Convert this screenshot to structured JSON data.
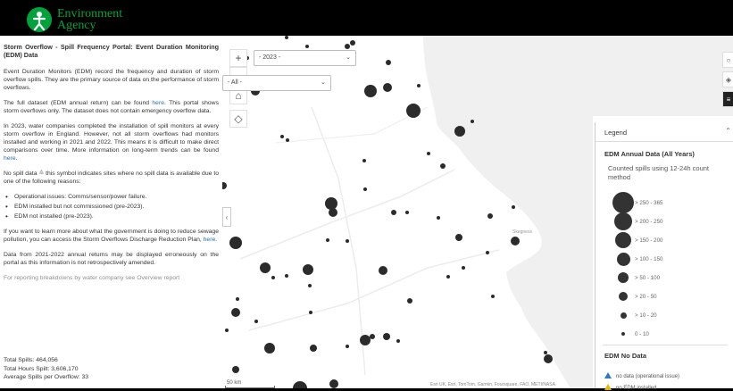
{
  "brand": {
    "name_line1": "Environment",
    "name_line2": "Agency",
    "color": "#00a33b"
  },
  "panel": {
    "title": "Storm Overflow - Spill Frequency Portal: Event Duration Monitoring (EDM) Data",
    "p1": "Event Duration Monitors (EDM) record the frequency and duration of storm overflow spills. They are the primary source of data on the performance of storm overflows.",
    "p2a": "The full dataset (EDM annual return) can be found ",
    "p2link": "here",
    "p2b": ". This portal shows storm overflows only. The dataset does not contain emergency overflow data.",
    "p3a": "In 2023, water companies completed the installation of spill monitors at every storm overflow in England. However, not all storm overflows had monitors installed and working in 2021 and 2022. This means it is difficult to make direct comparisons over time. More information on long-term trends can be found ",
    "p3link": "here",
    "p3b": ".",
    "p4a": "No spill data ",
    "p4b": " this symbol indicates sites where no spill data is available due to one of the following reasons:",
    "reasons": [
      "Operational issues: Comms/sensor/power failure.",
      "EDM installed but not commissioned (pre-2023).",
      "EDM not installed (pre-2023)."
    ],
    "p5a": "If you want to learn more about what the government is doing to reduce sewage pollution, you can access the Storm Overflows Discharge Reduction Plan, ",
    "p5link": "here",
    "p5b": ".",
    "p6": "Data from 2021-2022 annual returns may be displayed erroneously on the portal as this information is not retrospectively amended.",
    "p7": "For reporting breakdowns by water company see Overview report"
  },
  "stats": {
    "total_spills": "Total Spills: 464,056",
    "total_hours": "Total Hours Spilt: 3,606,170",
    "average": "Average Spills per Overflow: 33"
  },
  "filters": {
    "year": "- 2023 -",
    "company": "- All -"
  },
  "map_controls": {
    "zoom_in": "+",
    "zoom_out": "−",
    "collapse": "‹"
  },
  "legend": {
    "header": "Legend",
    "collapse_glyph": "⌃",
    "title": "EDM Annual Data (All Years)",
    "subtitle": "Counted spills using 12-24h count method",
    "classes": [
      "> 250 - 365",
      "> 200 - 250",
      "> 150 - 200",
      "> 100 - 150",
      "> 50 - 100",
      "> 20 - 50",
      "> 10 - 20",
      "0 - 10"
    ],
    "nodata_title": "EDM No Data",
    "nodata_items": [
      "no data (operational issue)",
      "no EDM installed"
    ],
    "nodata_colors": [
      "#2f78c4",
      "#e8b400"
    ]
  },
  "map_labels": {
    "skegness": "Skegness",
    "scale": "50 km"
  },
  "attribution": "Esri UK, Esri, TomTom, Garmin, Foursquare, FAO, METI/NASA",
  "icons": [
    "home-icon",
    "locate-icon",
    "search-icon",
    "layers-icon",
    "list-icon"
  ]
}
